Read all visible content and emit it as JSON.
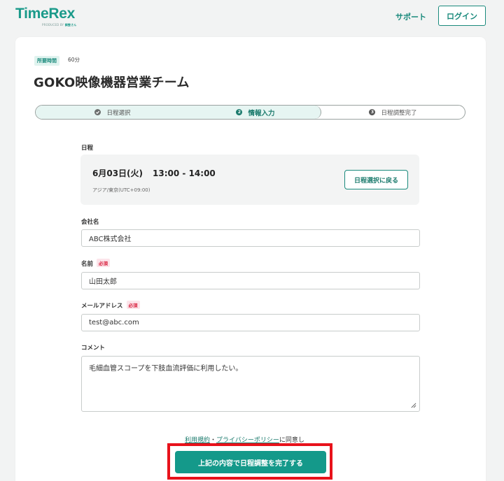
{
  "header": {
    "logo_text": "TimeRex",
    "logo_sub_prefix": "PRODUCED BY",
    "logo_sub_brand": "調整さん",
    "support_label": "サポート",
    "login_label": "ログイン"
  },
  "event": {
    "duration_label": "所要時間",
    "duration_value": "60分",
    "title": "GOKO映像機器営業チーム"
  },
  "steps": [
    {
      "label": "日程選択",
      "icon": "check-icon",
      "status": "done"
    },
    {
      "label": "情報入力",
      "icon": "2",
      "status": "current"
    },
    {
      "label": "日程調整完了",
      "icon": "3",
      "status": "pending"
    }
  ],
  "schedule": {
    "label": "日程",
    "date": "6月03日(火)",
    "time": "13:00 - 14:00",
    "timezone": "アジア/東京(UTC+09:00)",
    "back_button": "日程選択に戻る"
  },
  "form": {
    "company": {
      "label": "会社名",
      "value": "ABC株式会社"
    },
    "name": {
      "label": "名前",
      "required": "必須",
      "value": "山田太郎"
    },
    "email": {
      "label": "メールアドレス",
      "required": "必須",
      "value": "test@abc.com"
    },
    "comment": {
      "label": "コメント",
      "value": "毛細血管スコープを下肢血流評価に利用したい。"
    }
  },
  "agreement": {
    "terms": "利用規約",
    "separator": "・",
    "privacy": "プライバシーポリシー",
    "suffix": "に同意し"
  },
  "submit_label": "上記の内容で日程調整を完了する",
  "colors": {
    "brand": "#14998a",
    "highlight": "#e8121b",
    "required": "#d81e3c"
  }
}
